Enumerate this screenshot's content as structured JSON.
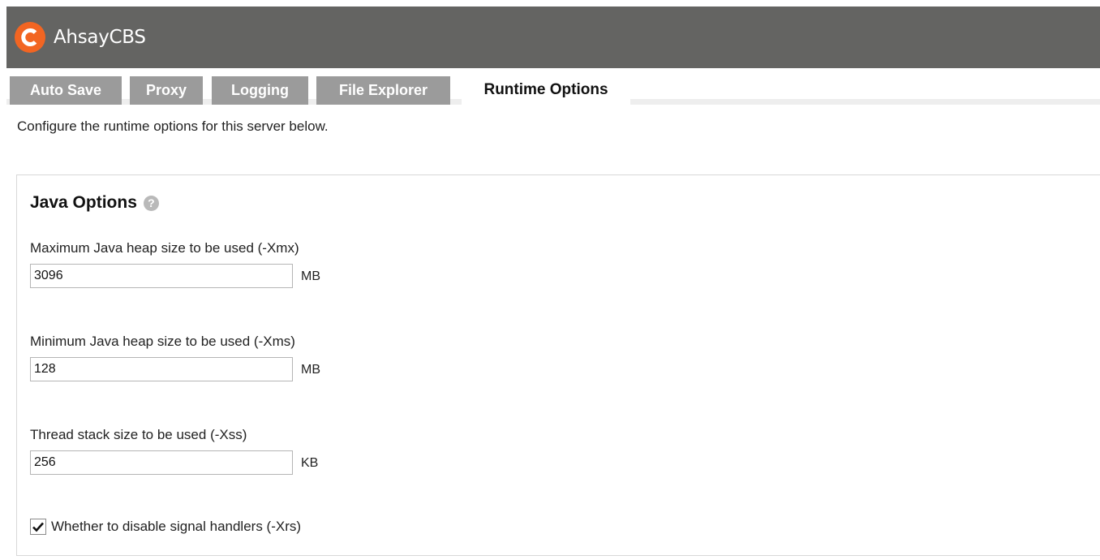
{
  "app": {
    "title": "AhsayCBS",
    "logo_letter": "C"
  },
  "tabs": [
    {
      "label": "Auto Save",
      "active": false
    },
    {
      "label": "Proxy",
      "active": false
    },
    {
      "label": "Logging",
      "active": false
    },
    {
      "label": "File Explorer",
      "active": false
    },
    {
      "label": "Runtime Options",
      "active": true
    }
  ],
  "intro": "Configure the runtime options for this server below.",
  "java_options": {
    "title": "Java Options",
    "help_icon": "question-circle-icon",
    "fields": [
      {
        "label": "Maximum Java heap size to be used (-Xmx)",
        "value": "3096",
        "unit": "MB"
      },
      {
        "label": "Minimum Java heap size to be used (-Xms)",
        "value": "128",
        "unit": "MB"
      },
      {
        "label": "Thread stack size to be used (-Xss)",
        "value": "256",
        "unit": "KB"
      }
    ],
    "checkbox": {
      "label": "Whether to disable signal handlers (-Xrs)",
      "checked": true
    }
  },
  "colors": {
    "topbar": "#646462",
    "brand": "#f26522",
    "tab": "#9b9b9b"
  }
}
